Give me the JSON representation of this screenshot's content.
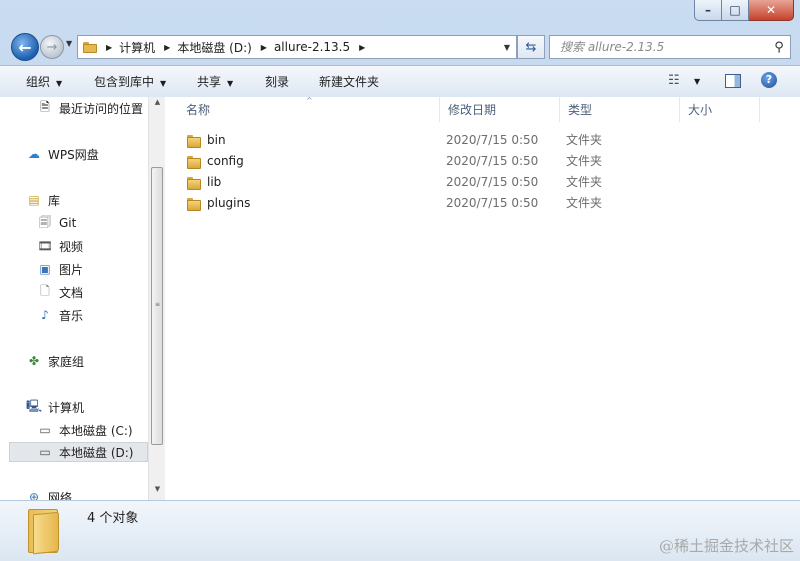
{
  "address": {
    "crumbs": [
      "计算机",
      "本地磁盘 (D:)",
      "allure-2.13.5"
    ]
  },
  "search": {
    "placeholder": "搜索 allure-2.13.5"
  },
  "toolbar": {
    "organize": "组织",
    "include_in_library": "包含到库中",
    "share": "共享",
    "burn": "刻录",
    "new_folder": "新建文件夹"
  },
  "sidebar": {
    "items": [
      {
        "label": "最近访问的位置",
        "icon": "recent-places-icon"
      },
      {
        "label": "WPS网盘",
        "icon": "cloud-icon"
      },
      {
        "label": "库",
        "icon": "library-icon"
      },
      {
        "label": "Git",
        "icon": "git-library-icon"
      },
      {
        "label": "视频",
        "icon": "video-icon"
      },
      {
        "label": "图片",
        "icon": "picture-icon"
      },
      {
        "label": "文档",
        "icon": "document-icon"
      },
      {
        "label": "音乐",
        "icon": "music-icon"
      },
      {
        "label": "家庭组",
        "icon": "homegroup-icon"
      },
      {
        "label": "计算机",
        "icon": "computer-icon"
      },
      {
        "label": "本地磁盘 (C:)",
        "icon": "drive-c-icon"
      },
      {
        "label": "本地磁盘 (D:)",
        "icon": "drive-d-icon",
        "selected": true
      },
      {
        "label": "网络",
        "icon": "network-icon"
      }
    ]
  },
  "columns": {
    "name": "名称",
    "date": "修改日期",
    "type": "类型",
    "size": "大小"
  },
  "files": [
    {
      "name": "bin",
      "date": "2020/7/15 0:50",
      "type": "文件夹"
    },
    {
      "name": "config",
      "date": "2020/7/15 0:50",
      "type": "文件夹"
    },
    {
      "name": "lib",
      "date": "2020/7/15 0:50",
      "type": "文件夹"
    },
    {
      "name": "plugins",
      "date": "2020/7/15 0:50",
      "type": "文件夹"
    }
  ],
  "status": {
    "count_text": "4 个对象"
  },
  "watermark": "@稀土掘金技术社区"
}
